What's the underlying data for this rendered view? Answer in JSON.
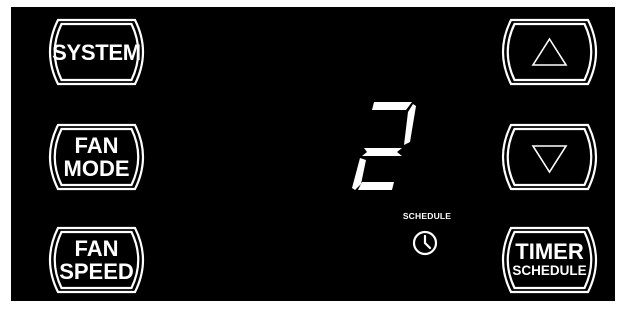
{
  "panel": {
    "background": "#000000",
    "foreground": "#ffffff"
  },
  "buttons": {
    "system": {
      "label": "SYSTEM"
    },
    "fan_mode": {
      "line1": "FAN",
      "line2": "MODE"
    },
    "fan_speed": {
      "line1": "FAN",
      "line2": "SPEED"
    },
    "up": {
      "icon": "up-triangle-icon"
    },
    "down": {
      "icon": "down-triangle-icon"
    },
    "timer": {
      "line1": "TIMER",
      "line2": "SCHEDULE"
    }
  },
  "display": {
    "digit": "2"
  },
  "schedule": {
    "label": "SCHEDULE",
    "icon": "clock-icon"
  }
}
